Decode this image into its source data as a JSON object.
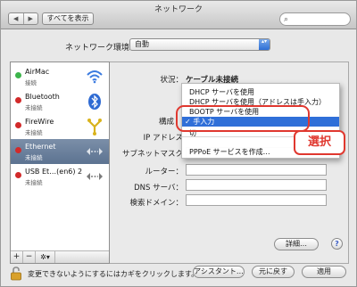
{
  "window": {
    "title": "ネットワーク",
    "show_all": "すべてを表示",
    "back_icon": "◀",
    "forward_icon": "▶",
    "search_icon": "⌕"
  },
  "location": {
    "label": "ネットワーク環境：",
    "value": "自動",
    "arrow": "▴▾"
  },
  "services": [
    {
      "name": "AirMac",
      "status": "接続",
      "dot_color": "#3cb44b",
      "icon": "wifi-icon"
    },
    {
      "name": "Bluetooth",
      "status": "未接続",
      "dot_color": "#d22a2a",
      "icon": "bluetooth-icon"
    },
    {
      "name": "FireWire",
      "status": "未接続",
      "dot_color": "#d22a2a",
      "icon": "firewire-icon"
    },
    {
      "name": "Ethernet",
      "status": "未接続",
      "dot_color": "#d22a2a",
      "icon": "ethernet-icon"
    },
    {
      "name": "USB Et…(en6) 2",
      "status": "未接続",
      "dot_color": "#d22a2a",
      "icon": "ethernet-icon"
    }
  ],
  "sidebar_controls": {
    "add": "+",
    "remove": "−",
    "gear": "✲▾"
  },
  "status": {
    "label": "状況：",
    "value": "ケーブル未接続"
  },
  "fields": {
    "config_label": "構成",
    "ip_label": "IP アドレス",
    "subnet_label": "サブネットマスク",
    "router_label": "ルーター：",
    "dns_label": "DNS サーバ：",
    "search_domain_label": "検索ドメイン："
  },
  "menu": {
    "items": [
      "DHCP サーバを使用",
      "DHCP サーバを使用（アドレスは手入力）",
      "BOOTP サーバを使用",
      "✓ 手入力",
      "切",
      "PPPoE サービスを作成…"
    ],
    "selected_index": 3
  },
  "callout": "選択",
  "buttons": {
    "advanced": "詳細…",
    "help": "?",
    "assistant": "アシスタント…",
    "revert": "元に戻す",
    "apply": "適用"
  },
  "lock_text": "変更できないようにするにはカギをクリックします。",
  "colors": {
    "accent": "#2f6fd8",
    "annotation": "#e0382f",
    "selected_row": "#6b819d"
  }
}
